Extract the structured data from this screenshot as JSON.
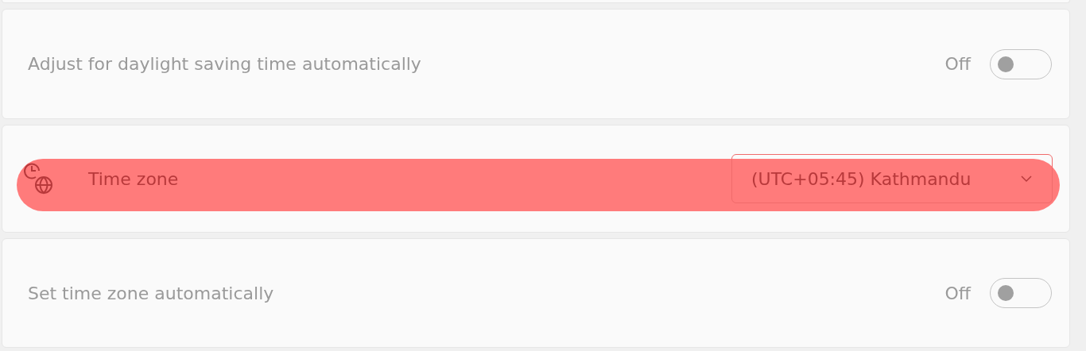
{
  "settings": [
    {
      "kind": "toggle",
      "label": "Adjust for daylight saving time automatically",
      "state_text": "Off",
      "on": false,
      "highlighted": false
    },
    {
      "kind": "dropdown",
      "label": "Time zone",
      "value": "(UTC+05:45) Kathmandu",
      "highlighted": true
    },
    {
      "kind": "toggle",
      "label": "Set time zone automatically",
      "state_text": "Off",
      "on": false,
      "highlighted": false
    }
  ]
}
